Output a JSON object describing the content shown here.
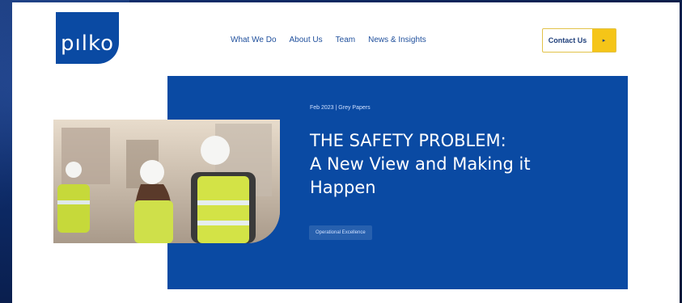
{
  "logo": {
    "text": "pılko"
  },
  "nav": {
    "items": [
      {
        "label": "What We Do"
      },
      {
        "label": "About Us"
      },
      {
        "label": "Team"
      },
      {
        "label": "News & Insights"
      }
    ]
  },
  "contact": {
    "label": "Contact Us",
    "arrow_icon": "▸"
  },
  "hero": {
    "meta": "Feb 2023  |  Grey Papers",
    "title_lines": [
      "THE SAFETY PROBLEM:",
      "A New View and Making it",
      "Happen"
    ],
    "tag": "Operational Excellence"
  },
  "colors": {
    "brand_blue": "#0a4aa3",
    "accent_yellow": "#f5c518"
  }
}
